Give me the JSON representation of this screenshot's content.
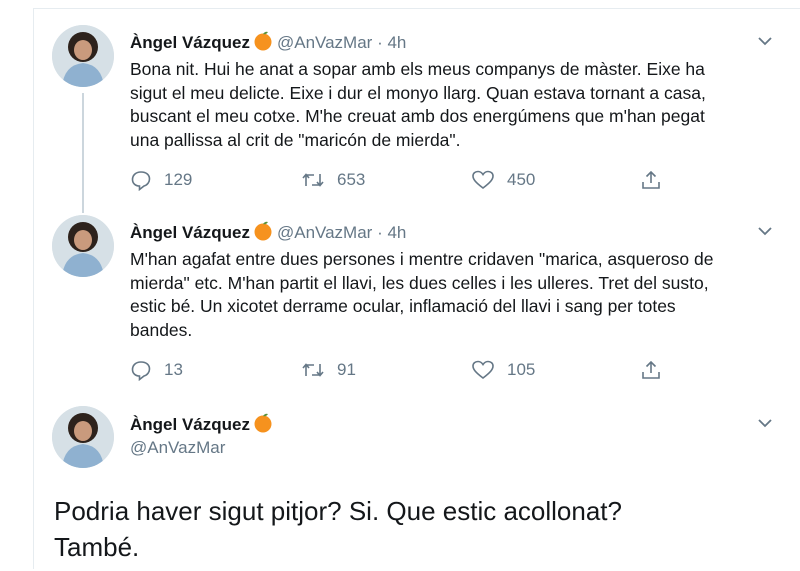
{
  "tweets": [
    {
      "name": "Àngel Vázquez",
      "handle": "@AnVazMar",
      "separator": "·",
      "time": "4h",
      "text": "Bona nit. Hui he anat a sopar amb els meus companys de màster. Eixe ha\nsigut el meu delicte. Eixe i dur el monyo llarg. Quan estava tornant a casa,\nbuscant el meu cotxe. M'he creuat amb dos energúmens que m'han pegat\nuna pallissa al crit de \"maricón de mierda\".",
      "replies": "129",
      "retweets": "653",
      "likes": "450"
    },
    {
      "name": "Àngel Vázquez",
      "handle": "@AnVazMar",
      "separator": "·",
      "time": "4h",
      "text": "M'han agafat entre dues persones i mentre cridaven \"marica, asqueroso de\nmierda\" etc. M'han partit el llavi, les dues celles i les ulleres. Tret del susto,\nestic bé. Un xicotet derrame ocular, inflamació del llavi i sang per totes\nbandes.",
      "replies": "13",
      "retweets": "91",
      "likes": "105"
    },
    {
      "name": "Àngel Vázquez",
      "handle": "@AnVazMar",
      "text": "Podria haver sigut pitjor? Si. Que estic acollonat?\nTambé."
    }
  ],
  "colors": {
    "accent_orange": "#f6921e",
    "muted": "#657786",
    "divider": "#e6ecf0",
    "thread_line": "#ccd6dd"
  },
  "icons": [
    "orange-emoji-icon",
    "chevron-down-icon",
    "reply-icon",
    "retweet-icon",
    "like-icon",
    "share-icon"
  ]
}
